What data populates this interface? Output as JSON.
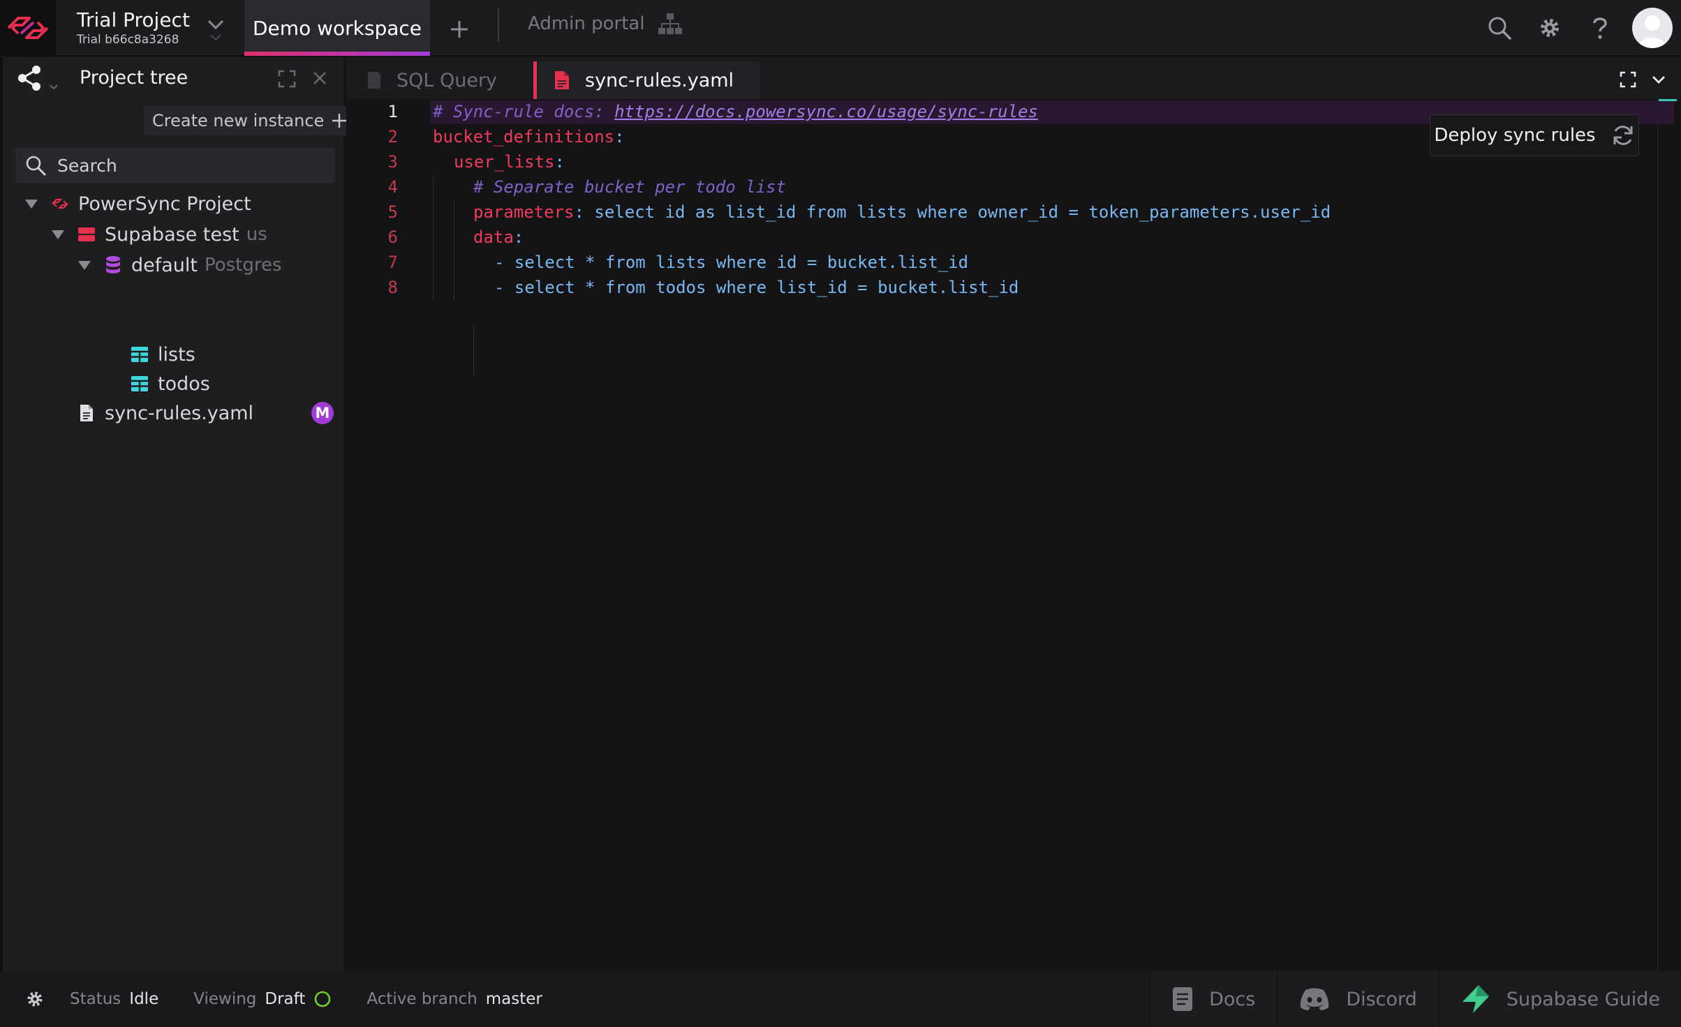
{
  "header": {
    "project_name": "Trial Project",
    "project_subtitle": "Trial b66c8a3268",
    "workspace_tab": "Demo workspace",
    "admin_portal": "Admin portal"
  },
  "sidebar": {
    "panel_title": "Project tree",
    "create_instance": "Create new instance",
    "search_placeholder": "Search",
    "tree": {
      "project": "PowerSync Project",
      "instance": "Supabase test",
      "instance_region": "us",
      "connection": "default",
      "connection_type": "Postgres",
      "table_1": "lists",
      "table_2": "todos",
      "file": "sync-rules.yaml",
      "file_badge": "M"
    }
  },
  "editor": {
    "tabs": [
      "SQL Query",
      "sync-rules.yaml"
    ],
    "active_tab": "sync-rules.yaml",
    "line_numbers": [
      "1",
      "2",
      "3",
      "4",
      "5",
      "6",
      "7",
      "8"
    ],
    "deploy_button": "Deploy sync rules",
    "lines": {
      "l1_comment": "# Sync-rule docs: ",
      "l1_url": "https://docs.powersync.co/usage/sync-rules",
      "l2_key": "bucket_definitions",
      "l2_colon": ":",
      "l3_key": "user_lists",
      "l3_colon": ":",
      "l4_comment": "# Separate bucket per todo list",
      "l5_key": "parameters",
      "l5_value": ": select id as list_id from lists where owner_id = token_parameters.user_id",
      "l6_key": "data",
      "l6_colon": ":",
      "l7": "- select * from lists where id = bucket.list_id",
      "l8": "- select * from todos where list_id = bucket.list_id"
    }
  },
  "status": {
    "status_label": "Status",
    "status_value": "Idle",
    "viewing_label": "Viewing",
    "viewing_value": "Draft",
    "branch_label": "Active branch",
    "branch_value": "master",
    "links": [
      "Docs",
      "Discord",
      "Supabase Guide"
    ]
  },
  "colors": {
    "accent_pink": "#e8304e",
    "accent_purple": "#a23cd8",
    "table_icon": "#3fd6e0",
    "supabase_green": "#3ecf8e",
    "status_ring": "#6fce2a"
  },
  "icons": [
    "powersync-logo",
    "chevron-down-icon",
    "plus-icon",
    "org-chart-icon",
    "search-icon",
    "gear-icon",
    "help-icon",
    "user-avatar",
    "share-icon",
    "expand-icon",
    "close-icon",
    "database-icon",
    "table-icon",
    "file-icon",
    "refresh-icon",
    "docs-icon",
    "discord-icon",
    "supabase-icon"
  ]
}
